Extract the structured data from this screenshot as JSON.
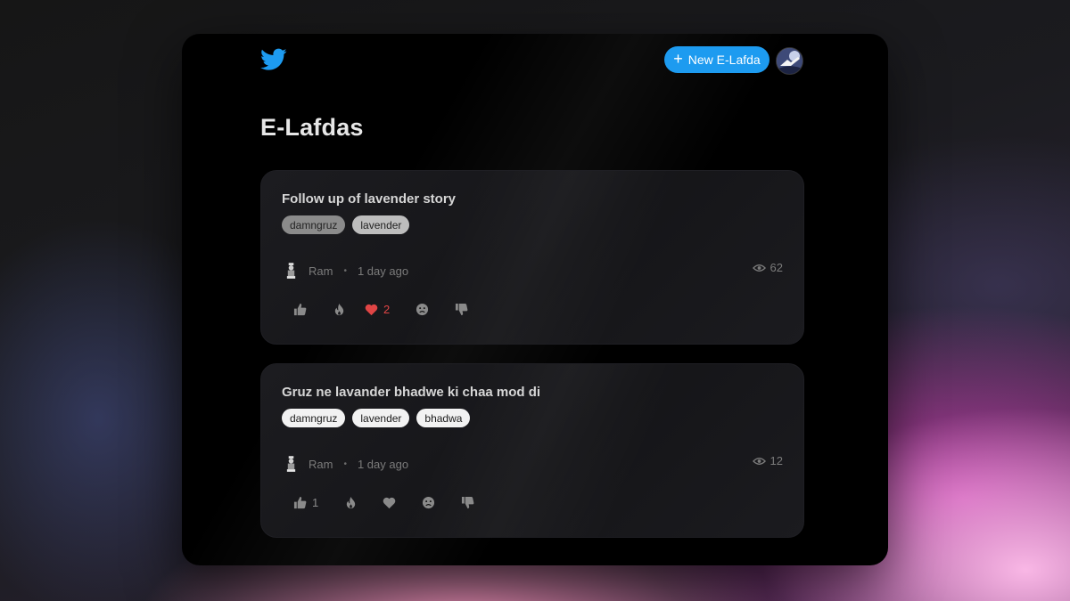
{
  "header": {
    "logo_icon": "twitter-bird-icon",
    "new_button_icon": "plus-icon",
    "new_button_label": "New E-Lafda",
    "accent_color": "#1d9bf0"
  },
  "page": {
    "title": "E-Lafdas"
  },
  "posts": [
    {
      "title": "Follow up of lavender story",
      "tags": [
        "damngruz",
        "lavender"
      ],
      "author": "Ram",
      "separator": "•",
      "time": "1 day ago",
      "views": "62",
      "reactions": {
        "like": "",
        "fire": "",
        "heart": "2",
        "sad": "",
        "dislike": ""
      }
    },
    {
      "title": "Gruz ne lavander bhadwe ki chaa mod di",
      "tags": [
        "damngruz",
        "lavender",
        "bhadwa"
      ],
      "author": "Ram",
      "separator": "•",
      "time": "1 day ago",
      "views": "12",
      "reactions": {
        "like": "1",
        "fire": "",
        "heart": "",
        "sad": "",
        "dislike": ""
      }
    }
  ]
}
